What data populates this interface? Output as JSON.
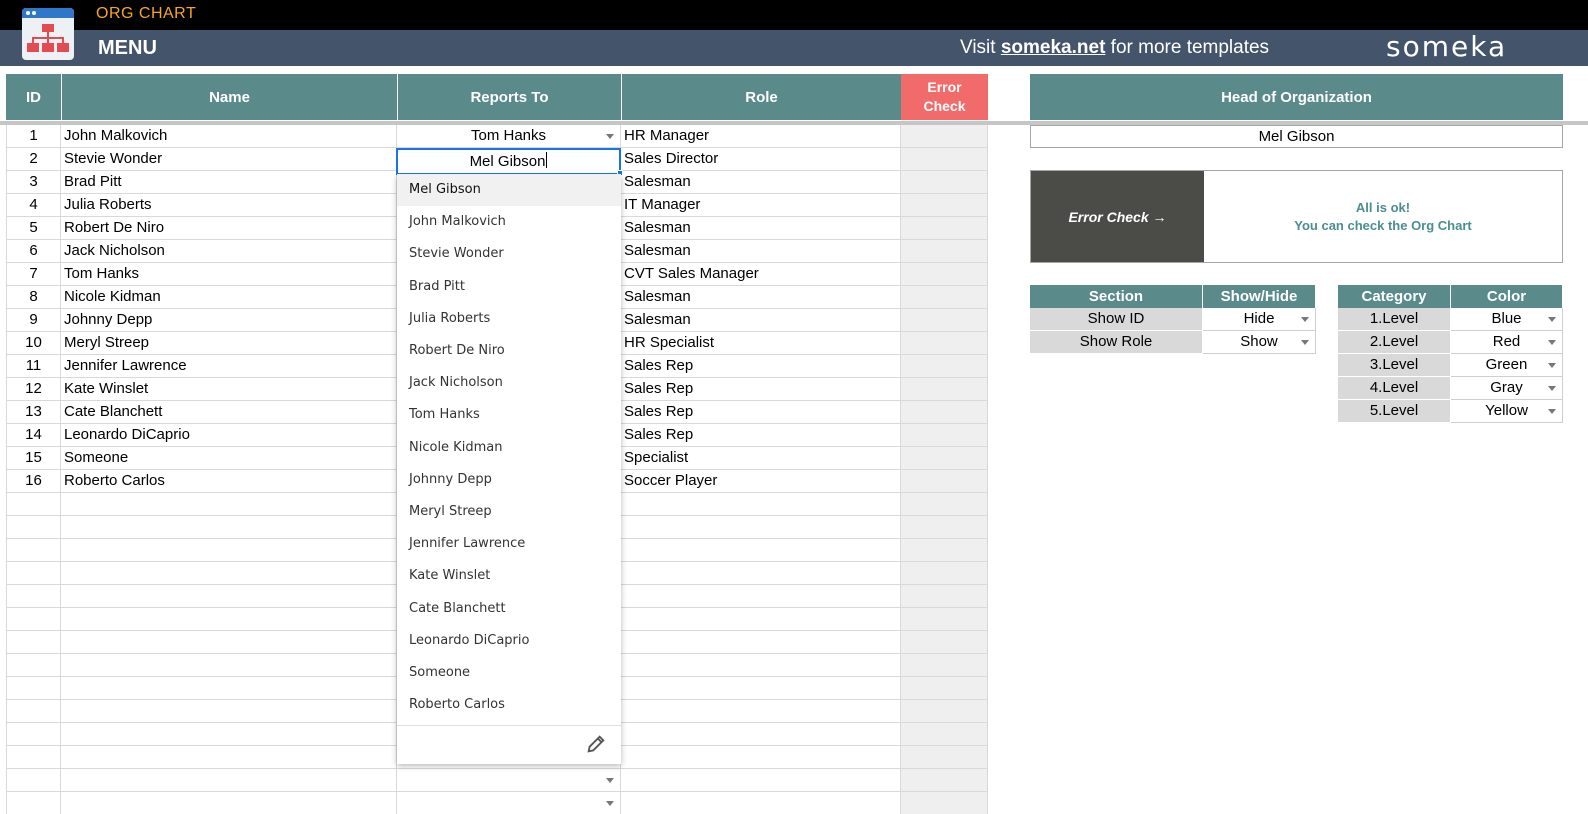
{
  "header": {
    "app_title": "ORG CHART",
    "menu_label": "MENU",
    "visit_prefix": "Visit ",
    "visit_link": "someka.net",
    "visit_suffix": " for more templates",
    "brand": "someka"
  },
  "table": {
    "headers": {
      "id": "ID",
      "name": "Name",
      "reports_to": "Reports To",
      "role": "Role",
      "error_check_line1": "Error",
      "error_check_line2": "Check"
    },
    "rows": [
      {
        "id": "1",
        "name": "John Malkovich",
        "reports_to": "Tom Hanks",
        "role": "HR Manager"
      },
      {
        "id": "2",
        "name": "Stevie Wonder",
        "reports_to": "",
        "role": "Sales Director"
      },
      {
        "id": "3",
        "name": "Brad Pitt",
        "reports_to": "",
        "role": "Salesman"
      },
      {
        "id": "4",
        "name": "Julia Roberts",
        "reports_to": "",
        "role": "IT Manager"
      },
      {
        "id": "5",
        "name": "Robert De Niro",
        "reports_to": "",
        "role": "Salesman"
      },
      {
        "id": "6",
        "name": "Jack Nicholson",
        "reports_to": "",
        "role": "Salesman"
      },
      {
        "id": "7",
        "name": "Tom Hanks",
        "reports_to": "",
        "role": "CVT Sales Manager"
      },
      {
        "id": "8",
        "name": "Nicole Kidman",
        "reports_to": "",
        "role": "Salesman"
      },
      {
        "id": "9",
        "name": "Johnny Depp",
        "reports_to": "",
        "role": "Salesman"
      },
      {
        "id": "10",
        "name": "Meryl Streep",
        "reports_to": "",
        "role": "HR Specialist"
      },
      {
        "id": "11",
        "name": "Jennifer Lawrence",
        "reports_to": "",
        "role": "Sales Rep"
      },
      {
        "id": "12",
        "name": "Kate Winslet",
        "reports_to": "",
        "role": "Sales Rep"
      },
      {
        "id": "13",
        "name": "Cate Blanchett",
        "reports_to": "",
        "role": "Sales Rep"
      },
      {
        "id": "14",
        "name": "Leonardo DiCaprio",
        "reports_to": "",
        "role": "Sales Rep"
      },
      {
        "id": "15",
        "name": "Someone",
        "reports_to": "",
        "role": "Specialist"
      },
      {
        "id": "16",
        "name": "Roberto Carlos",
        "reports_to": "",
        "role": "Soccer Player"
      }
    ]
  },
  "editor": {
    "value": "Mel Gibson"
  },
  "dropdown": {
    "selected": "Mel Gibson",
    "options": [
      "Mel Gibson",
      "John Malkovich",
      "Stevie Wonder",
      "Brad Pitt",
      "Julia Roberts",
      "Robert De Niro",
      "Jack Nicholson",
      "Tom Hanks",
      "Nicole Kidman",
      "Johnny Depp",
      "Meryl Streep",
      "Jennifer Lawrence",
      "Kate Winslet",
      "Cate Blanchett",
      "Leonardo DiCaprio",
      "Someone",
      "Roberto Carlos"
    ],
    "edit_icon": "pencil-icon"
  },
  "head_of_org": {
    "title": "Head of Organization",
    "value": "Mel Gibson"
  },
  "error_check": {
    "label": "Error Check →",
    "msg_line1": "All is ok!",
    "msg_line2": "You can check the Org Chart"
  },
  "sections": {
    "headers": [
      "Section",
      "Show/Hide"
    ],
    "rows": [
      {
        "section": "Show ID",
        "value": "Hide"
      },
      {
        "section": "Show Role",
        "value": "Show"
      }
    ]
  },
  "categories": {
    "headers": [
      "Category",
      "Color"
    ],
    "rows": [
      {
        "category": "1.Level",
        "color": "Blue"
      },
      {
        "category": "2.Level",
        "color": "Red"
      },
      {
        "category": "3.Level",
        "color": "Green"
      },
      {
        "category": "4.Level",
        "color": "Gray"
      },
      {
        "category": "5.Level",
        "color": "Yellow"
      }
    ]
  },
  "colors": {
    "header_teal": "#5a8a8a",
    "error_red": "#f26b6b",
    "menu_bar": "#44546a",
    "accent_orange": "#f6a623",
    "selection_blue": "#1a73e8"
  }
}
